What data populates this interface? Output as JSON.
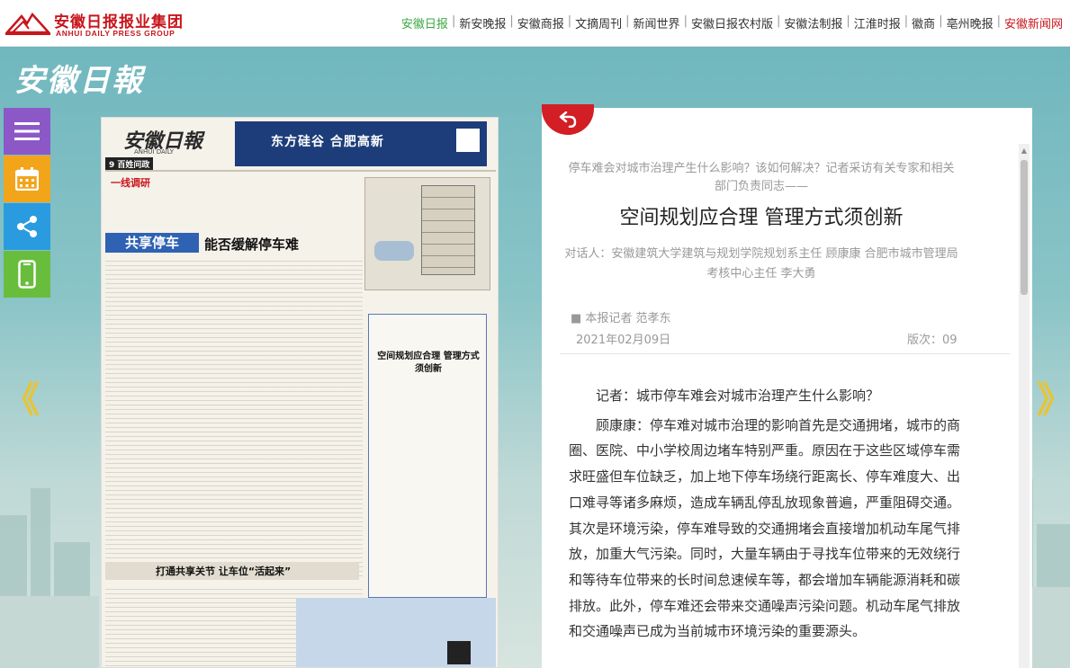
{
  "header": {
    "logo_cn": "安徽日报报业集团",
    "logo_en": "ANHUI DAILY PRESS GROUP",
    "nav": [
      {
        "label": "安徽日报",
        "state": "active"
      },
      {
        "label": "新安晚报",
        "state": "normal"
      },
      {
        "label": "安徽商报",
        "state": "normal"
      },
      {
        "label": "文摘周刊",
        "state": "normal"
      },
      {
        "label": "新闻世界",
        "state": "normal"
      },
      {
        "label": "安徽日报农村版",
        "state": "normal"
      },
      {
        "label": "安徽法制报",
        "state": "normal"
      },
      {
        "label": "江淮时报",
        "state": "normal"
      },
      {
        "label": "徽商",
        "state": "normal"
      },
      {
        "label": "亳州晚报",
        "state": "normal"
      },
      {
        "label": "安徽新闻网",
        "state": "highlight"
      }
    ]
  },
  "band_title": "安徽日報",
  "tools": [
    {
      "name": "menu-icon"
    },
    {
      "name": "calendar-icon"
    },
    {
      "name": "share-icon"
    },
    {
      "name": "phone-icon"
    }
  ],
  "arrows": {
    "prev": "《",
    "next": "》"
  },
  "paper": {
    "masthead": "安徽日報",
    "masthead_en": "ANHUI DAILY",
    "section": "9 百姓问政",
    "ad_banner": "东方硅谷 合肥高新",
    "headline_prefix": "共享停车",
    "headline_main": "能否缓解停车难",
    "column": "一线调研",
    "bottom_headline": "打通共享关节 让车位“活起来”",
    "inset_title": "空间规划应合理 管理方式须创新"
  },
  "article": {
    "subtitle": "停车难会对城市治理产生什么影响？该如何解决？记者采访有关专家和相关部门负责同志——",
    "title": "空间规划应合理 管理方式须创新",
    "speakers": "对话人：安徽建筑大学建筑与规划学院规划系主任 顾康康 合肥市城市管理局考核中心主任 李大勇",
    "reporter": "■ 本报记者 范孝东",
    "date": "2021年02月09日",
    "page": "版次：09",
    "paragraphs": [
      "记者：城市停车难会对城市治理产生什么影响？",
      "顾康康：停车难对城市治理的影响首先是交通拥堵，城市的商圈、医院、中小学校周边堵车特别严重。原因在于这些区域停车需求旺盛但车位缺乏，加上地下停车场绕行距离长、停车难度大、出口难寻等诸多麻烦，造成车辆乱停乱放现象普遍，严重阻碍交通。其次是环境污染，停车难导致的交通拥堵会直接增加机动车尾气排放，加重大气污染。同时，大量车辆由于寻找车位带来的无效绕行和等待车位带来的长时间怠速候车等，都会增加车辆能源消耗和碳排放。此外，停车难还会带来交通噪声污染问题。机动车尾气排放和交通噪声已成为当前城市环境污染的重要源头。"
    ]
  },
  "colors": {
    "brand_red": "#c8161d",
    "active_green": "#3aa842",
    "band_teal": "#70b7be"
  }
}
